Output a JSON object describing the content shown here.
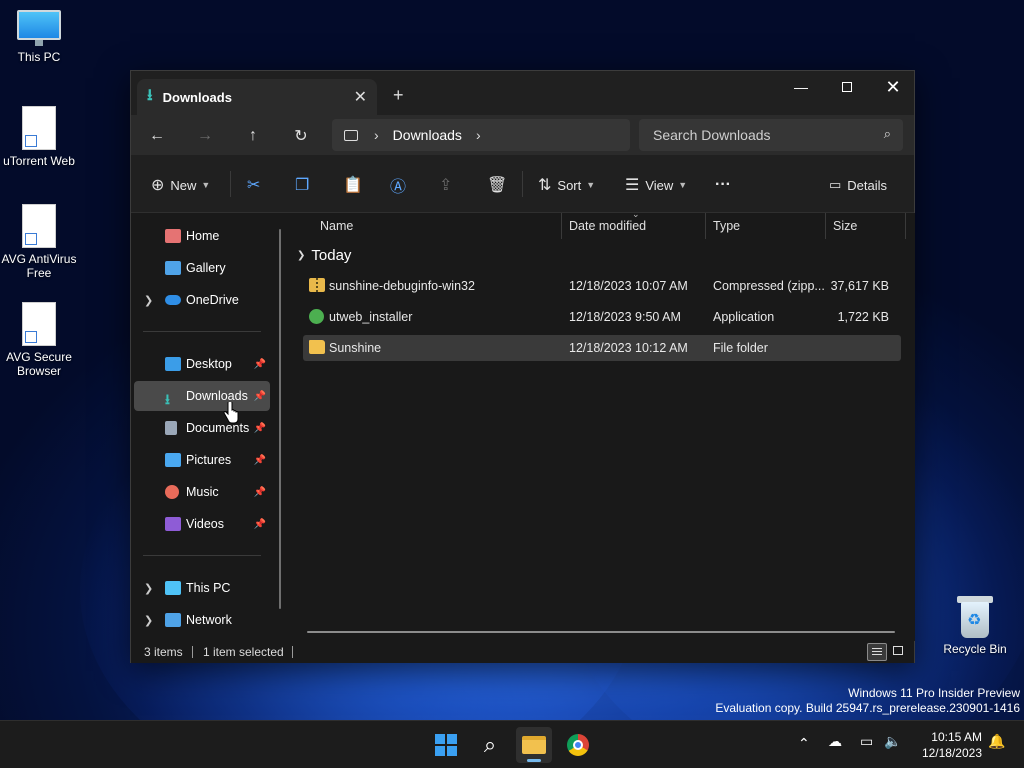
{
  "desktop": {
    "icons": [
      {
        "label": "This PC"
      },
      {
        "label": "uTorrent Web"
      },
      {
        "label": "AVG AntiVirus Free"
      },
      {
        "label": "AVG Secure Browser"
      },
      {
        "label": "Recycle Bin"
      }
    ],
    "watermark": {
      "line1": "Windows 11 Pro Insider Preview",
      "line2": "Evaluation copy. Build 25947.rs_prerelease.230901-1416"
    }
  },
  "explorer": {
    "tab": {
      "title": "Downloads",
      "close": "✕",
      "new_tab": "+"
    },
    "window_controls": {
      "minimize": "—",
      "close": "✕"
    },
    "nav": {
      "back": "←",
      "forward": "→",
      "up": "↑",
      "refresh": "↻"
    },
    "address": {
      "chevron": "›",
      "crumb": "Downloads"
    },
    "search": {
      "placeholder": "Search Downloads"
    },
    "toolbar": {
      "new_label": "New",
      "sort_label": "Sort",
      "view_label": "View",
      "more_label": "···",
      "details_label": "Details"
    },
    "sidebar": {
      "items": [
        {
          "label": "Home",
          "icon": "home-icon",
          "color": "#e57373"
        },
        {
          "label": "Gallery",
          "icon": "gallery-icon",
          "color": "#4fa3e8"
        },
        {
          "label": "OneDrive",
          "icon": "cloud-icon",
          "color": "#2f8ee6"
        },
        {
          "label": "Desktop",
          "icon": "desktop-icon",
          "color": "#3b9de8"
        },
        {
          "label": "Downloads",
          "icon": "download-icon",
          "color": "#3ac1b8"
        },
        {
          "label": "Documents",
          "icon": "document-icon",
          "color": "#9aa7b8"
        },
        {
          "label": "Pictures",
          "icon": "pictures-icon",
          "color": "#4aa8f0"
        },
        {
          "label": "Music",
          "icon": "music-icon",
          "color": "#e86b5a"
        },
        {
          "label": "Videos",
          "icon": "videos-icon",
          "color": "#8e5cd6"
        },
        {
          "label": "This PC",
          "icon": "computer-icon",
          "color": "#4fc3f7"
        },
        {
          "label": "Network",
          "icon": "network-icon",
          "color": "#4fa3e8"
        }
      ]
    },
    "columns": [
      "Name",
      "Date modified",
      "Type",
      "Size"
    ],
    "group": "Today",
    "files": [
      {
        "name": "sunshine-debuginfo-win32",
        "date": "12/18/2023 10:07 AM",
        "type": "Compressed (zipp...",
        "size": "37,617 KB",
        "icon": "zip-icon"
      },
      {
        "name": "utweb_installer",
        "date": "12/18/2023 9:50 AM",
        "type": "Application",
        "size": "1,722 KB",
        "icon": "app-icon"
      },
      {
        "name": "Sunshine",
        "date": "12/18/2023 10:12 AM",
        "type": "File folder",
        "size": "",
        "icon": "folder-icon"
      }
    ],
    "status": {
      "count": "3 items",
      "selected": "1 item selected"
    }
  },
  "taskbar": {
    "tray_chevron": "⌃",
    "clock": {
      "time": "10:15 AM",
      "date": "12/18/2023"
    }
  }
}
